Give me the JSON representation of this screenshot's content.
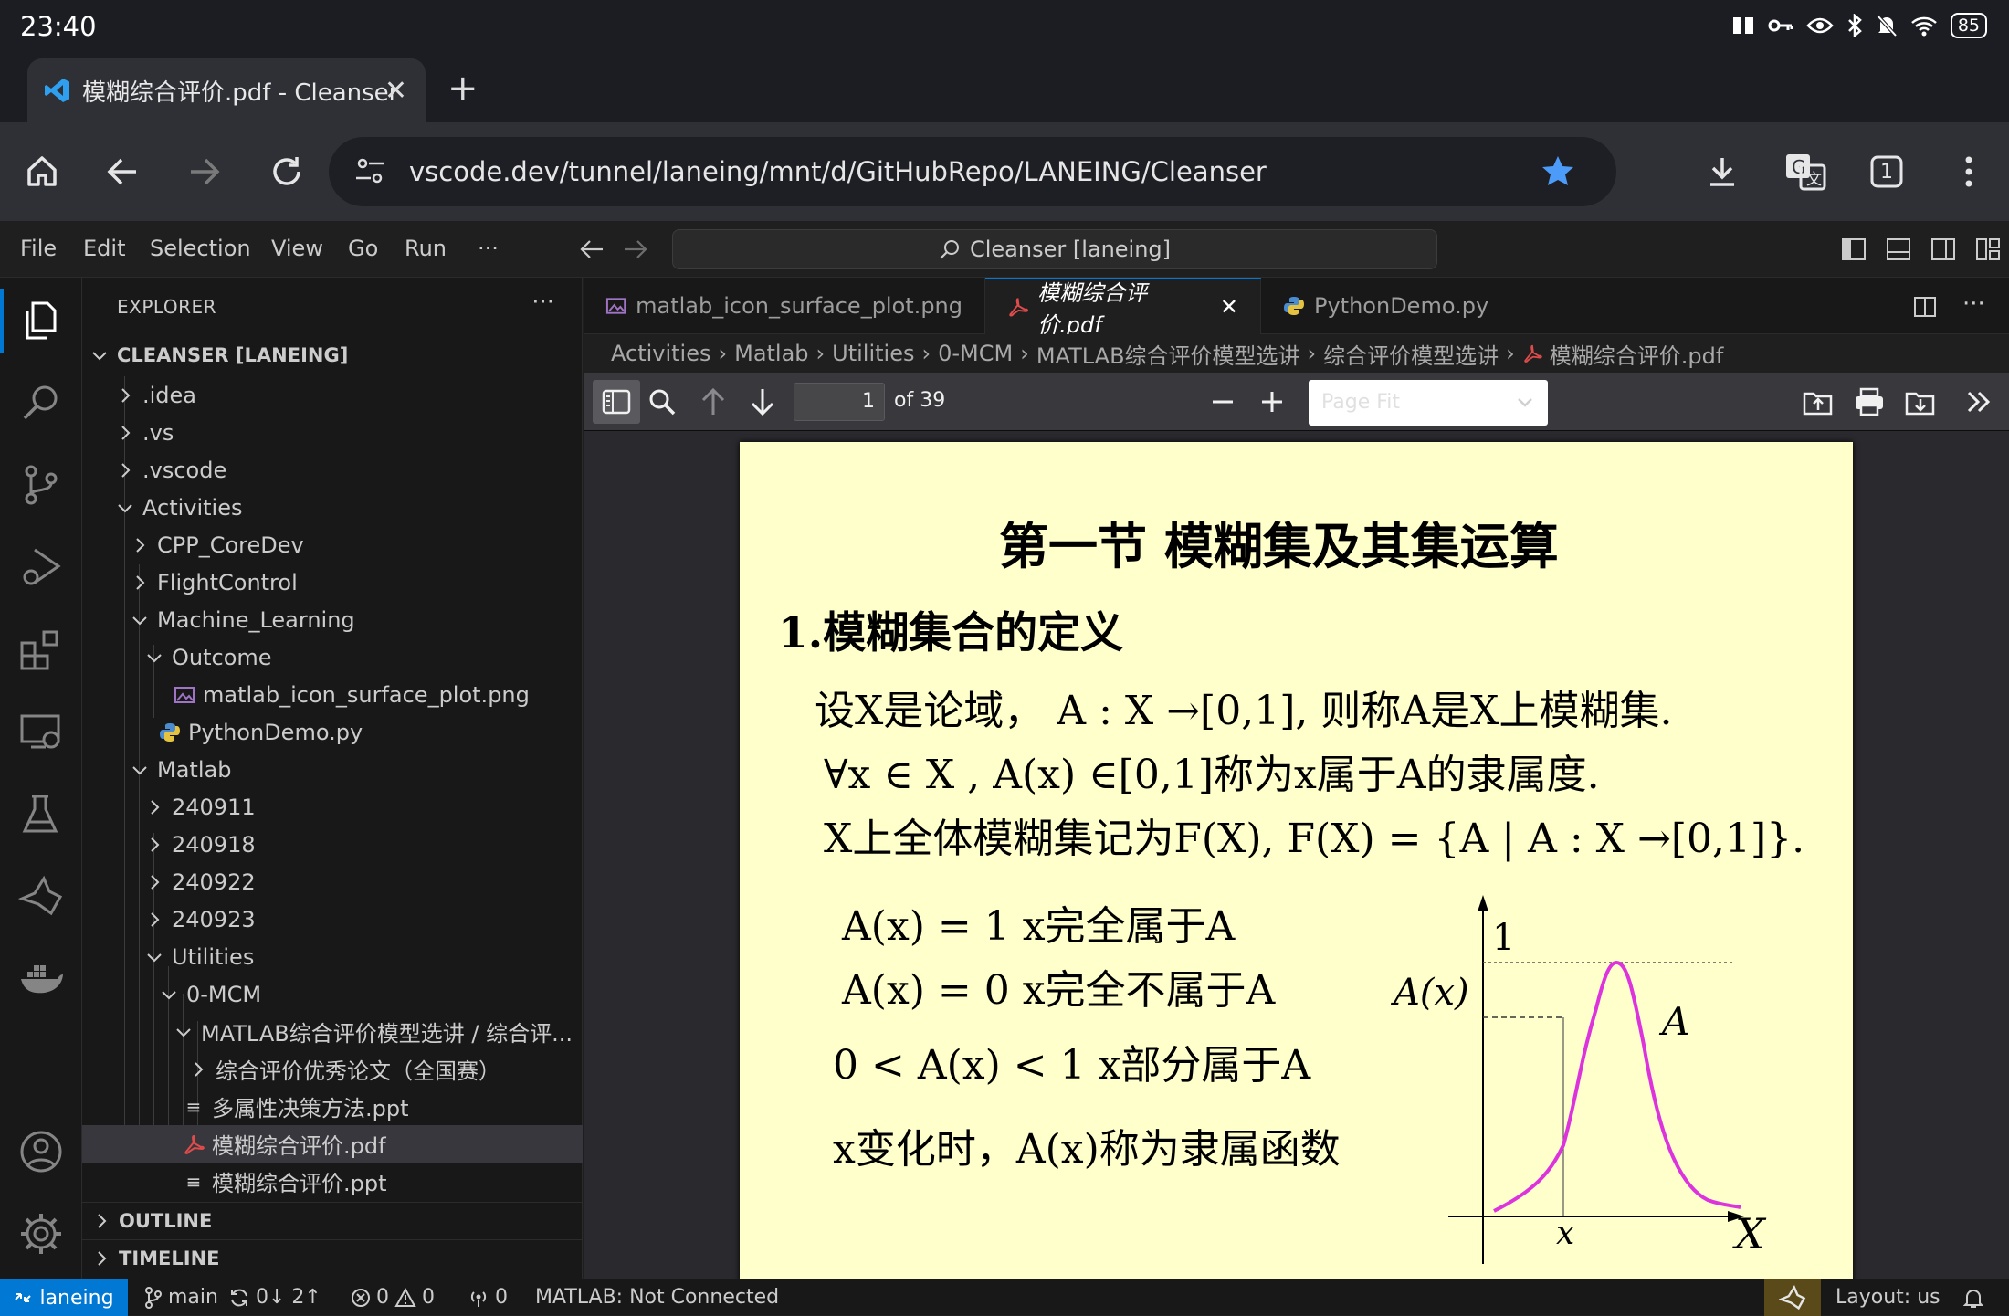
{
  "status": {
    "time": "23:40",
    "battery": "85"
  },
  "browser": {
    "tab_title": "模糊综合评价.pdf - Cleanser",
    "url": "vscode.dev/tunnel/laneing/mnt/d/GitHubRepo/LANEING/Cleanser",
    "tab_count": "1"
  },
  "menu": [
    "File",
    "Edit",
    "Selection",
    "View",
    "Go",
    "Run",
    "···"
  ],
  "command_center": "Cleanser [laneing]",
  "sidebar": {
    "title": "EXPLORER",
    "root": "CLEANSER [LANEING]",
    "items": [
      ".idea",
      ".vs",
      ".vscode",
      "Activities",
      "CPP_CoreDev",
      "FlightControl",
      "Machine_Learning",
      "Outcome",
      "matlab_icon_surface_plot.png",
      "PythonDemo.py",
      "Matlab",
      "240911",
      "240918",
      "240922",
      "240923",
      "Utilities",
      "0-MCM",
      "MATLAB综合评价模型选讲 / 综合评...",
      "综合评价优秀论文（全国赛）",
      "多属性决策方法.ppt",
      "模糊综合评价.pdf",
      "模糊综合评价.ppt"
    ],
    "outline": "OUTLINE",
    "timeline": "TIMELINE"
  },
  "editor_tabs": [
    "matlab_icon_surface_plot.png",
    "模糊综合评价.pdf",
    "PythonDemo.py"
  ],
  "breadcrumb": [
    "Activities",
    "Matlab",
    "Utilities",
    "0-MCM",
    "MATLAB综合评价模型选讲",
    "综合评价模型选讲",
    "模糊综合评价.pdf"
  ],
  "pdf_toolbar": {
    "page": "1",
    "of": "of 39",
    "zoom": "Page Fit"
  },
  "slide": {
    "title": "第一节 模糊集及其集运算",
    "heading": "1.模糊集合的定义",
    "lines": [
      "设X是论域， A : X →[0,1], 则称A是X上模糊集.",
      "∀x ∈ X , A(x) ∈[0,1]称为x属于A的隶属度.",
      "X上全体模糊集记为F(X),  F(X) = {A | A : X →[0,1]}."
    ],
    "cases": [
      "A(x) = 1   x完全属于A",
      "A(x) = 0   x完全不属于A",
      "0 < A(x) < 1   x部分属于A",
      "x变化时，A(x)称为隶属函数"
    ],
    "graph": {
      "y_one": "1",
      "y_label": "A(x)",
      "curve_label": "A",
      "x_tick": "x",
      "x_label": "X"
    }
  },
  "statusbar": {
    "remote": "laneing",
    "branch": "main",
    "sync": "0↓ 2↑",
    "problems": "0",
    "warnings": "0",
    "ports": "0",
    "matlab": "MATLAB: Not Connected",
    "layout": "Layout: us"
  }
}
